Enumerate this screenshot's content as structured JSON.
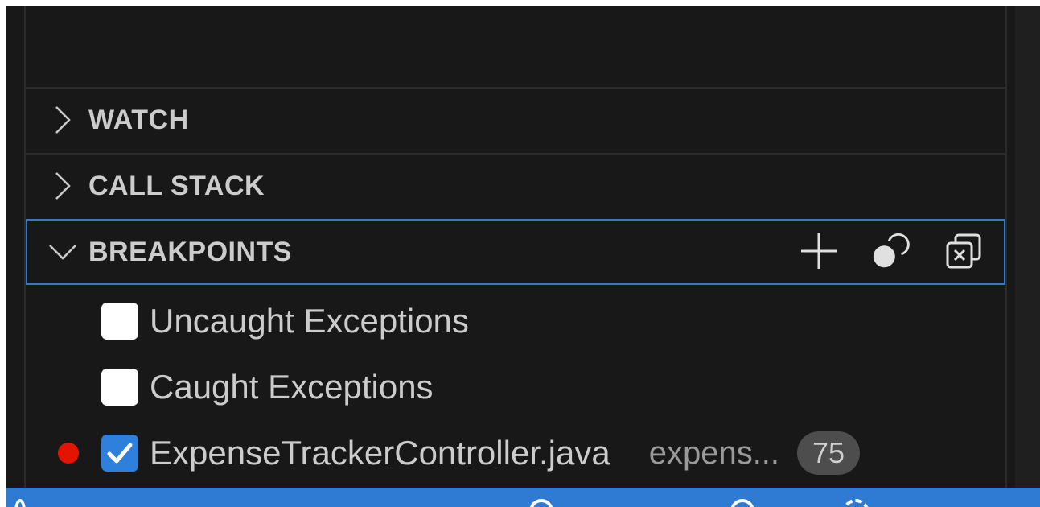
{
  "sections": {
    "watch": {
      "title": "WATCH",
      "expanded": false
    },
    "call_stack": {
      "title": "CALL STACK",
      "expanded": false
    },
    "breakpoints": {
      "title": "BREAKPOINTS",
      "expanded": true,
      "actions": [
        {
          "name": "add-function-breakpoint",
          "icon": "plus-icon"
        },
        {
          "name": "toggle-activate-breakpoints",
          "icon": "activate-breakpoints-icon"
        },
        {
          "name": "remove-all-breakpoints",
          "icon": "close-all-icon"
        }
      ],
      "items": [
        {
          "label": "Uncaught Exceptions",
          "checked": false,
          "has_dot": false
        },
        {
          "label": "Caught Exceptions",
          "checked": false,
          "has_dot": false
        },
        {
          "label": "ExpenseTrackerController.java",
          "description": "expens...",
          "line": "75",
          "checked": true,
          "has_dot": true
        }
      ]
    }
  },
  "colors": {
    "panel_bg": "#181818",
    "focus_border": "#2f7bd3",
    "breakpoint_dot": "#e51400",
    "checkbox_checked": "#2f7fdc",
    "status_bar": "#2f7bd3"
  }
}
